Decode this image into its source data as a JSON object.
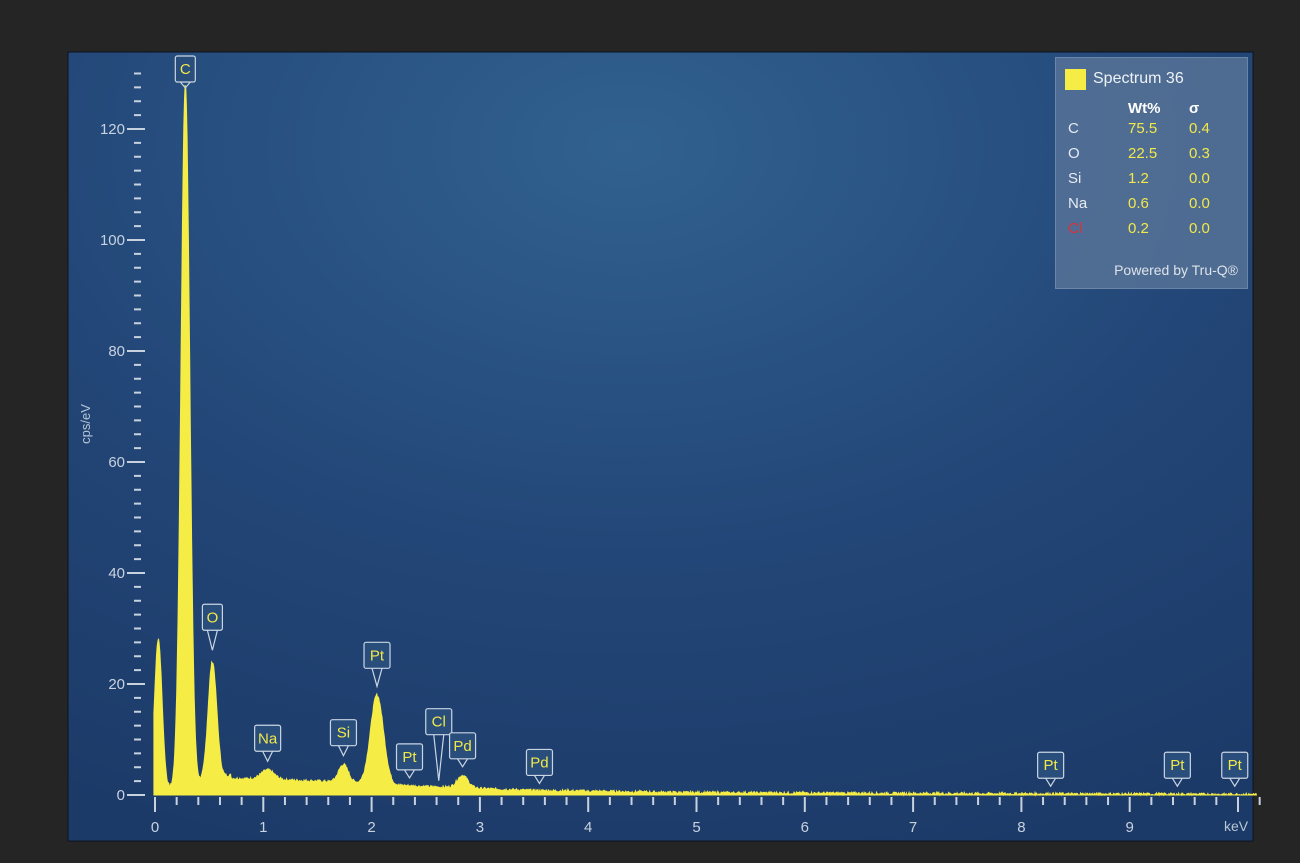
{
  "colors": {
    "spectrum": "#f5ec45",
    "background_outer": "#252525",
    "plot_bg_center": "#2f5f8e",
    "plot_bg_edge": "#1d3d6b",
    "axis": "#c8d2df",
    "warning_element": "#d8323a"
  },
  "chart_data": {
    "type": "area",
    "title": "",
    "xlabel": "keV",
    "ylabel": "cps/eV",
    "xlim": [
      -0.05,
      10.3
    ],
    "ylim": [
      0,
      130
    ],
    "x_ticks": [
      0,
      1,
      2,
      3,
      4,
      5,
      6,
      7,
      8,
      9
    ],
    "y_ticks": [
      0,
      20,
      40,
      60,
      80,
      100,
      120
    ],
    "grid": false,
    "legend_position": "top-right",
    "series": [
      {
        "name": "Spectrum 36",
        "peaks": [
          {
            "x": 0.03,
            "y": 28
          },
          {
            "x": 0.28,
            "y": 128
          },
          {
            "x": 0.53,
            "y": 24
          },
          {
            "x": 1.04,
            "y": 4.5
          },
          {
            "x": 1.74,
            "y": 5.5
          },
          {
            "x": 2.05,
            "y": 18
          },
          {
            "x": 2.84,
            "y": 3.5
          }
        ],
        "baseline": [
          {
            "x": 0.7,
            "y": 3
          },
          {
            "x": 1.5,
            "y": 2.5
          },
          {
            "x": 2.5,
            "y": 1.5
          },
          {
            "x": 3.5,
            "y": 0.8
          },
          {
            "x": 5,
            "y": 0.4
          },
          {
            "x": 8,
            "y": 0.2
          },
          {
            "x": 10,
            "y": 0.1
          }
        ]
      }
    ],
    "peak_labels": [
      {
        "label": "C",
        "x": 0.28,
        "y": 128
      },
      {
        "label": "O",
        "x": 0.53,
        "y": 25
      },
      {
        "label": "Na",
        "x": 1.04,
        "y": 5
      },
      {
        "label": "Si",
        "x": 1.74,
        "y": 6
      },
      {
        "label": "Pt",
        "x": 2.05,
        "y": 18.5
      },
      {
        "label": "Pt",
        "x": 2.35,
        "y": 2
      },
      {
        "label": "Cl",
        "x": 2.62,
        "y": 1.5
      },
      {
        "label": "Pd",
        "x": 2.84,
        "y": 4
      },
      {
        "label": "Pd",
        "x": 3.55,
        "y": 1
      },
      {
        "label": "Pt",
        "x": 8.27,
        "y": 0.5
      },
      {
        "label": "Pt",
        "x": 9.44,
        "y": 0.5
      },
      {
        "label": "Pt",
        "x": 9.97,
        "y": 0.5
      }
    ]
  },
  "legend": {
    "title": "Spectrum 36",
    "header_wt": "Wt%",
    "header_sigma": "σ",
    "rows": [
      {
        "element": "C",
        "wt": "75.5",
        "sigma": "0.4"
      },
      {
        "element": "O",
        "wt": "22.5",
        "sigma": "0.3"
      },
      {
        "element": "Si",
        "wt": "1.2",
        "sigma": "0.0"
      },
      {
        "element": "Na",
        "wt": "0.6",
        "sigma": "0.0"
      },
      {
        "element": "Cl",
        "wt": "0.2",
        "sigma": "0.0"
      }
    ],
    "footer": "Powered by Tru-Q®"
  }
}
